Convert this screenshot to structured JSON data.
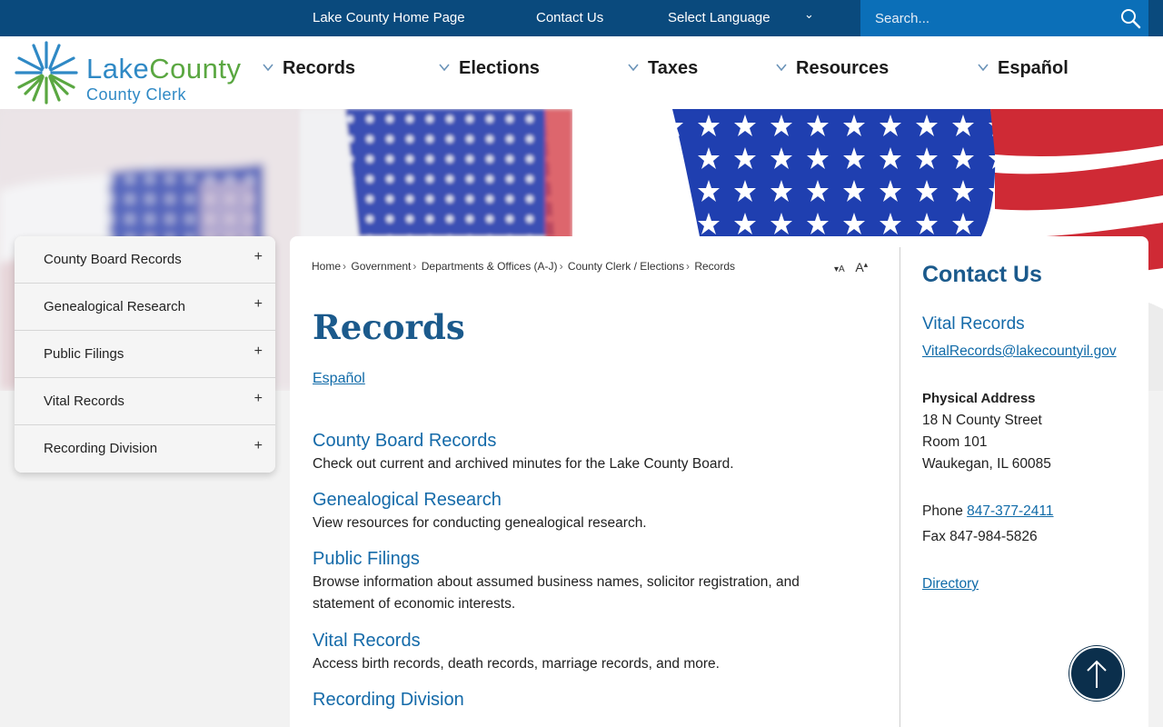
{
  "topbar": {
    "home_link": "Lake County Home Page",
    "contact_link": "Contact Us",
    "language_label": "Select Language",
    "search_placeholder": "Search..."
  },
  "logo": {
    "line1_part1": "Lake",
    "line1_part2": "County",
    "line2": "County Clerk"
  },
  "nav": {
    "items": [
      {
        "label": "Records"
      },
      {
        "label": "Elections"
      },
      {
        "label": "Taxes"
      },
      {
        "label": "Resources"
      },
      {
        "label": "Español"
      }
    ]
  },
  "sidenav": {
    "items": [
      {
        "label": "County Board Records",
        "icon": "+"
      },
      {
        "label": "Genealogical Research",
        "icon": "+"
      },
      {
        "label": "Public Filings",
        "icon": "+"
      },
      {
        "label": "Vital Records",
        "icon": "+"
      },
      {
        "label": "Recording Division",
        "icon": "+"
      }
    ]
  },
  "breadcrumb": {
    "items": [
      "Home",
      "Government",
      "Departments & Offices (A-J)",
      "County Clerk / Elections",
      "Records"
    ]
  },
  "main": {
    "title": "Records",
    "espanol_link": "Español",
    "sections": [
      {
        "title": "County Board Records",
        "desc": "Check out current and archived minutes for the Lake County Board."
      },
      {
        "title": "Genealogical Research",
        "desc": "View resources for conducting genealogical research."
      },
      {
        "title": "Public Filings",
        "desc": "Browse information about assumed business names, solicitor registration, and statement of economic interests."
      },
      {
        "title": "Vital Records",
        "desc": "Access birth records, death records, marriage records, and more."
      },
      {
        "title": "Recording Division",
        "desc": ""
      }
    ]
  },
  "contact": {
    "title": "Contact Us",
    "subtitle": "Vital Records",
    "email": "VitalRecords@lakecountyil.gov",
    "address_label": "Physical Address",
    "address_line1": "18 N County Street",
    "address_line2": "Room 101",
    "address_line3": "Waukegan, IL 60085",
    "phone_label": "Phone",
    "phone": "847-377-2411",
    "fax": "Fax 847-984-5826",
    "directory_link": "Directory"
  },
  "colors": {
    "topbar": "#0a4a7d",
    "search": "#0b6fb8",
    "heading": "#1b5a8c",
    "link": "#146aa9"
  }
}
